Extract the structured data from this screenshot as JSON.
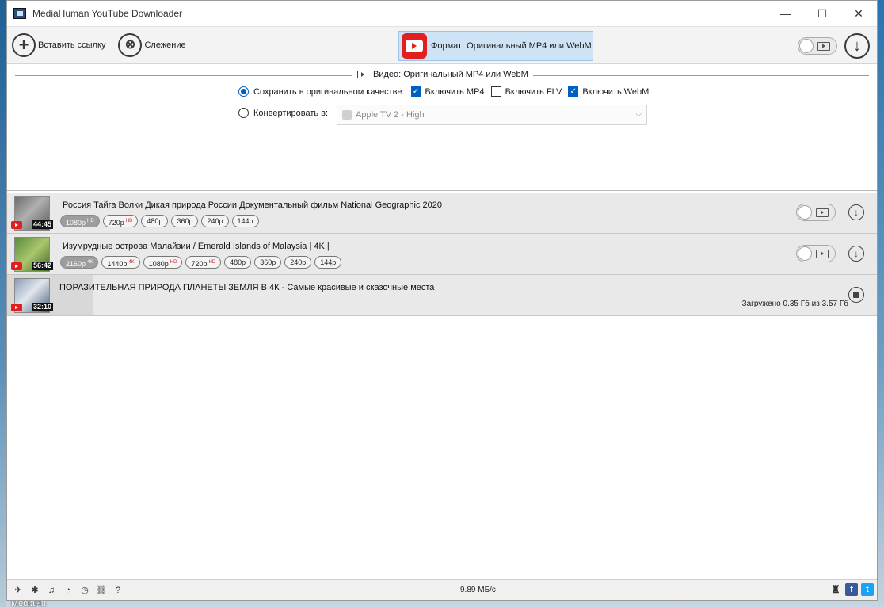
{
  "window": {
    "title": "MediaHuman YouTube Downloader",
    "minimize_glyph": "—",
    "maximize_glyph": "☐",
    "close_glyph": "✕"
  },
  "toolbar": {
    "paste_label": "Вставить ссылку",
    "paste_icon": "+",
    "tracking_label": "Слежение",
    "tracking_icon": "⊗",
    "format_label": "Формат: Оригинальный MP4 или WebM",
    "download_all_icon": "↓"
  },
  "settings": {
    "section_title": "Видео: Оригинальный MP4 или WebM",
    "keep_original_label": "Сохранить в оригинальном качестве:",
    "keep_original_selected": true,
    "include_mp4_label": "Включить MP4",
    "include_mp4_checked": true,
    "include_flv_label": "Включить FLV",
    "include_flv_checked": false,
    "include_webm_label": "Включить WebM",
    "include_webm_checked": true,
    "convert_label": "Конвертировать в:",
    "convert_selected": false,
    "convert_value": "Apple TV 2 - High",
    "check_glyph": "✓",
    "dropdown_arrow": "⌵"
  },
  "downloads": [
    {
      "title": "Россия Тайга Волки Дикая природа России Документальный фильм National Geographic 2020",
      "duration": "44:45",
      "resolutions": [
        {
          "label": "1080p",
          "tag": "HD",
          "selected": true
        },
        {
          "label": "720p",
          "tag": "HD",
          "selected": false
        },
        {
          "label": "480p",
          "tag": "",
          "selected": false
        },
        {
          "label": "360p",
          "tag": "",
          "selected": false
        },
        {
          "label": "240p",
          "tag": "",
          "selected": false
        },
        {
          "label": "144p",
          "tag": "",
          "selected": false
        }
      ]
    },
    {
      "title": "Изумрудные острова Малайзии / Emerald Islands of Malaysia | 4K |",
      "duration": "56:42",
      "resolutions": [
        {
          "label": "2160p",
          "tag": "4K",
          "selected": true
        },
        {
          "label": "1440p",
          "tag": "4K",
          "selected": false
        },
        {
          "label": "1080p",
          "tag": "HD",
          "selected": false
        },
        {
          "label": "720p",
          "tag": "HD",
          "selected": false
        },
        {
          "label": "480p",
          "tag": "",
          "selected": false
        },
        {
          "label": "360p",
          "tag": "",
          "selected": false
        },
        {
          "label": "240p",
          "tag": "",
          "selected": false
        },
        {
          "label": "144p",
          "tag": "",
          "selected": false
        }
      ]
    },
    {
      "title": "ПОРАЗИТЕЛЬНАЯ ПРИРОДА ПЛАНЕТЫ ЗЕМЛЯ В 4К - Самые красивые и сказочные места",
      "duration": "32:10",
      "status": "Загружено 0.35 Гб из 3.57 Гб",
      "progress": 0.098
    }
  ],
  "row_download_icon": "↓",
  "statusbar": {
    "icons": [
      "✈",
      "✱",
      "♫",
      "◔",
      "◷",
      "⛓",
      "?"
    ],
    "speed": "9.89 МБ/с",
    "facebook_glyph": "f",
    "twitter_glyph": "t",
    "agent_glyph": "♜"
  },
  "desktop": {
    "taskbar_label": "MediaHu"
  }
}
